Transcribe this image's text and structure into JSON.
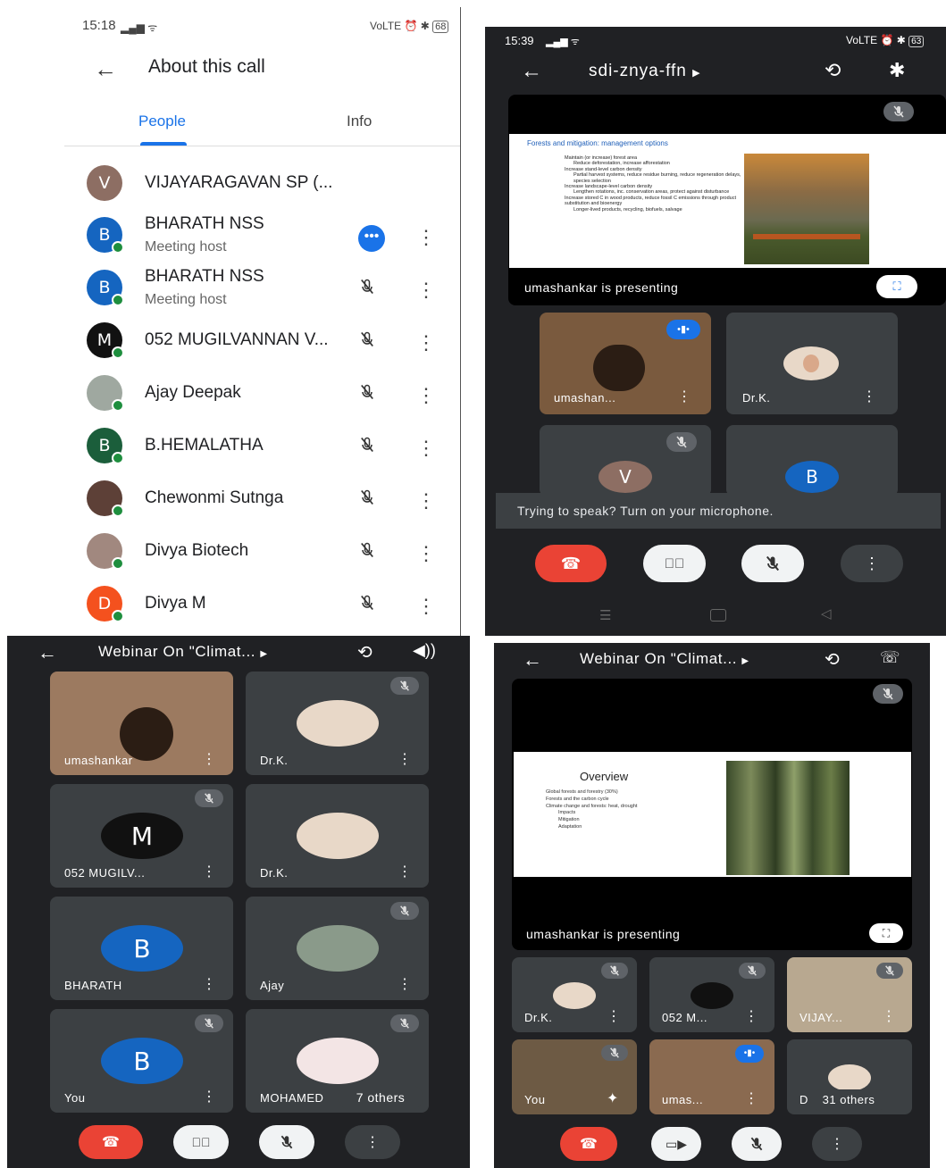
{
  "panel_a": {
    "status_time": "15:18",
    "status_right": "68",
    "title": "About this call",
    "tabs": [
      "People",
      "Info"
    ],
    "people": [
      {
        "initial": "V",
        "name": "VIJAYARAGAVAN SP (...",
        "subtitle": "",
        "color": "#8d6e63",
        "state": "none"
      },
      {
        "initial": "B",
        "name": "BHARATH NSS",
        "subtitle": "Meeting host",
        "color": "#1565c0",
        "state": "speaking"
      },
      {
        "initial": "B",
        "name": "BHARATH NSS",
        "subtitle": "Meeting host",
        "color": "#1565c0",
        "state": "muted"
      },
      {
        "initial": "M",
        "name": "052 MUGILVANNAN V...",
        "subtitle": "",
        "color": "#111111",
        "state": "muted"
      },
      {
        "initial": "",
        "name": "Ajay Deepak",
        "subtitle": "",
        "color": "#9fa8a0",
        "state": "muted"
      },
      {
        "initial": "B",
        "name": "B.HEMALATHA",
        "subtitle": "",
        "color": "#1b5e3b",
        "state": "muted"
      },
      {
        "initial": "",
        "name": "Chewonmi Sutnga",
        "subtitle": "",
        "color": "#5d4037",
        "state": "muted"
      },
      {
        "initial": "",
        "name": "Divya Biotech",
        "subtitle": "",
        "color": "#a1887f",
        "state": "muted"
      },
      {
        "initial": "D",
        "name": "Divya M",
        "subtitle": "",
        "color": "#f4511e",
        "state": "muted"
      }
    ]
  },
  "panel_b": {
    "status_time": "15:39",
    "status_right": "63",
    "meeting_code": "sdi-znya-ffn",
    "slide": {
      "heading": "Forests and mitigation: management options",
      "bullets": [
        "Maintain (or increase) forest area",
        "Reduce deforestation, increase afforestation",
        "Increase stand-level carbon density",
        "Partial harvest systems, reduce residue burning, reduce regeneration delays, species selection",
        "Increase landscape-level carbon density",
        "Lengthen rotations, inc. conservation areas, protect against disturbance",
        "Increase stored C in wood products, reduce fossil C emissions through product substitution and bioenergy",
        "Longer-lived products, recycling, biofuels, salvage"
      ]
    },
    "presenting": "umashankar is presenting",
    "tiles": [
      {
        "name": "umashan...",
        "initial": ""
      },
      {
        "name": "Dr.K.",
        "initial": ""
      },
      {
        "name": "",
        "initial": "V"
      },
      {
        "name": "",
        "initial": "B"
      }
    ],
    "toast": "Trying to speak? Turn on your microphone."
  },
  "panel_c": {
    "title": "Webinar On \"Climat...",
    "tiles": [
      {
        "name": "umashankar",
        "initial": ""
      },
      {
        "name": "Dr.K.",
        "initial": ""
      },
      {
        "name": "052 MUGILV...",
        "initial": "M"
      },
      {
        "name": "Dr.K.",
        "initial": ""
      },
      {
        "name": "BHARATH",
        "initial": "B"
      },
      {
        "name": "Ajay",
        "initial": ""
      },
      {
        "name": "You",
        "initial": "B"
      },
      {
        "name": "MOHAMED",
        "initial": ""
      }
    ],
    "others": "7 others"
  },
  "panel_d": {
    "title": "Webinar On \"Climat...",
    "slide": {
      "heading": "Overview",
      "bullets": [
        "Global forests and forestry (30%)",
        "Forests and the carbon cycle",
        "Climate change and forests: heat, drought",
        "Impacts",
        "Mitigation",
        "Adaptation"
      ]
    },
    "presenting": "umashankar is presenting",
    "tiles": [
      {
        "name": "Dr.K."
      },
      {
        "name": "052 M..."
      },
      {
        "name": "VIJAY..."
      },
      {
        "name": "You"
      },
      {
        "name": "umas..."
      },
      {
        "name": "D"
      }
    ],
    "others": "31 others"
  }
}
